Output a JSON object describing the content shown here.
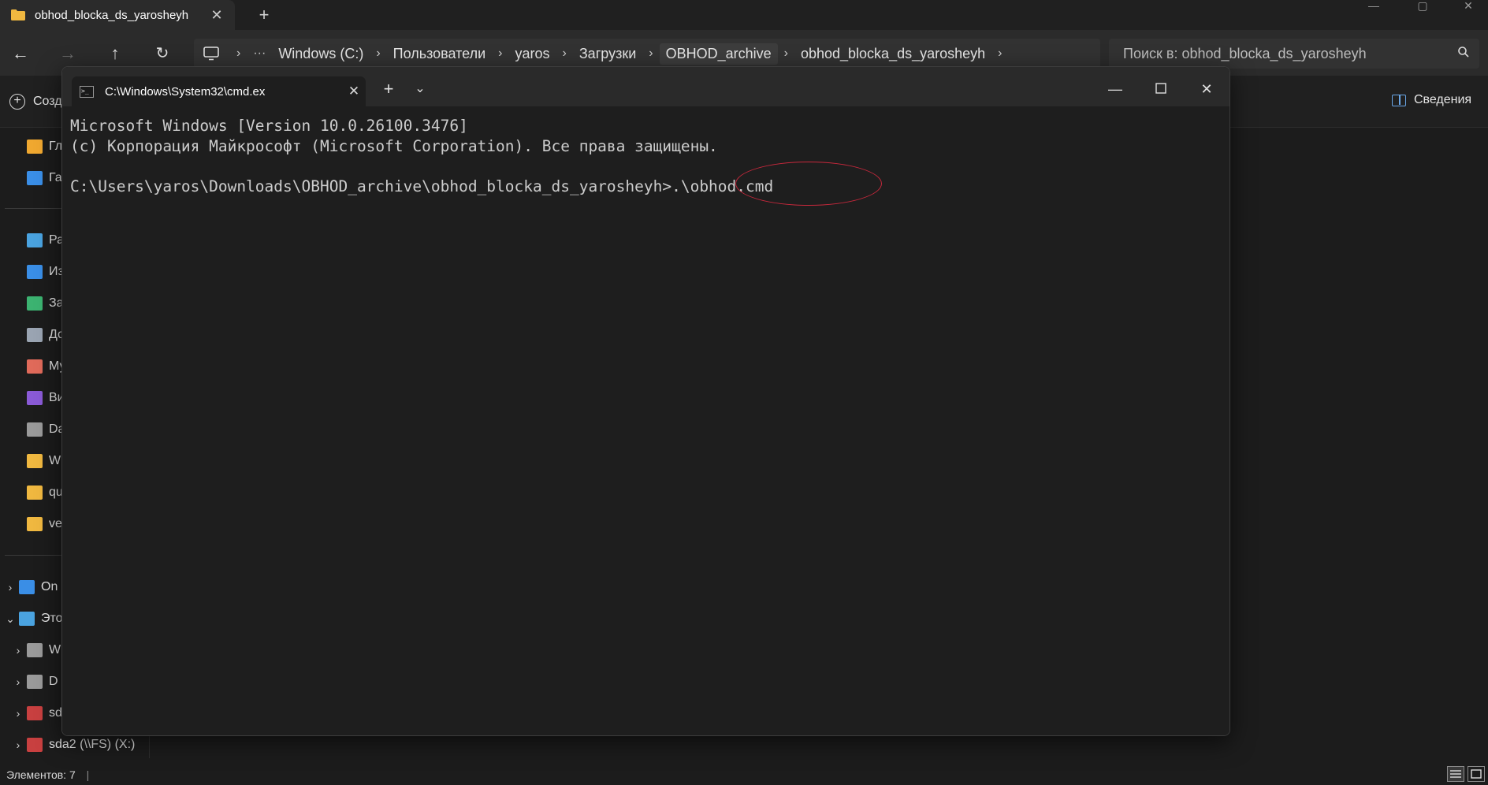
{
  "explorer": {
    "tab_title": "obhod_blocka_ds_yarosheyh",
    "breadcrumbs": [
      "Windows (C:)",
      "Пользователи",
      "yaros",
      "Загрузки",
      "OBHOD_archive",
      "obhod_blocka_ds_yarosheyh"
    ],
    "search_placeholder": "Поиск в: obhod_blocka_ds_yarosheyh",
    "create_label": "Созд",
    "details_label": "Сведения",
    "quick_items": [
      {
        "label": "Гла",
        "icon": "home-icon",
        "color": "#f0a830"
      },
      {
        "label": "Гал",
        "icon": "gallery-icon",
        "color": "#3a8ee6"
      }
    ],
    "library_items": [
      {
        "label": "Раб",
        "icon": "desktop-icon",
        "color": "#4aa3e0"
      },
      {
        "label": "Изо",
        "icon": "pictures-icon",
        "color": "#3a8ee6"
      },
      {
        "label": "Заг",
        "icon": "download-icon",
        "color": "#3cb371"
      },
      {
        "label": "Док",
        "icon": "documents-icon",
        "color": "#9aa4b2"
      },
      {
        "label": "Муз",
        "icon": "music-icon",
        "color": "#e06a5a"
      },
      {
        "label": "Вид",
        "icon": "video-icon",
        "color": "#8a5ad6"
      },
      {
        "label": "Da",
        "icon": "drive-icon",
        "color": "#9a9a9a"
      },
      {
        "label": "WE",
        "icon": "folder-icon",
        "color": "#f0b840"
      },
      {
        "label": "qui",
        "icon": "folder-icon",
        "color": "#f0b840"
      },
      {
        "label": "vel",
        "icon": "folder-icon",
        "color": "#f0b840"
      }
    ],
    "tree_items": [
      {
        "label": "On",
        "icon": "onedrive-icon",
        "color": "#3a8ee6",
        "chev": "›"
      },
      {
        "label": "Это",
        "icon": "this-pc-icon",
        "color": "#4aa3e0",
        "chev": "⌄"
      },
      {
        "label": "W",
        "icon": "windows-drive-icon",
        "color": "#9a9a9a",
        "chev": "›"
      },
      {
        "label": "D",
        "icon": "drive-icon",
        "color": "#9a9a9a",
        "chev": "›"
      },
      {
        "label": "sd",
        "icon": "network-drive-icon",
        "color": "#c84040",
        "chev": "›"
      },
      {
        "label": "sda2 (\\\\FS) (X:)",
        "icon": "network-drive-icon",
        "color": "#c84040",
        "chev": "›"
      }
    ],
    "status_count": "Элементов: 7"
  },
  "terminal": {
    "tab_title": "C:\\Windows\\System32\\cmd.ex",
    "lines": [
      "Microsoft Windows [Version 10.0.26100.3476]",
      "(c) Корпорация Майкрософт (Microsoft Corporation). Все права защищены."
    ],
    "prompt": "C:\\Users\\yaros\\Downloads\\OBHOD_archive\\obhod_blocka_ds_yarosheyh>.\\obhod.cmd",
    "highlight_color": "#c8283c"
  }
}
